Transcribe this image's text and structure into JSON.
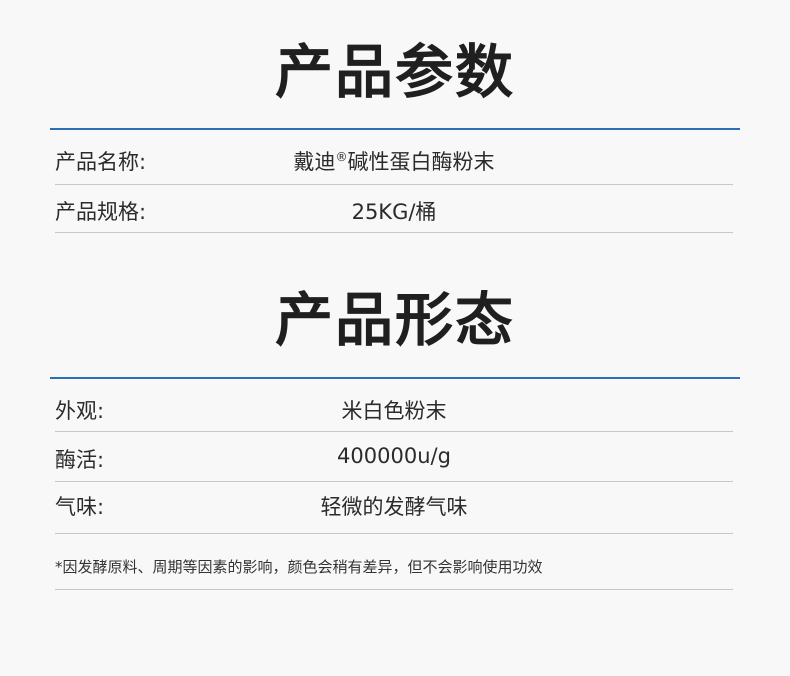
{
  "params": {
    "title": "产品参数",
    "rows": [
      {
        "label": "产品名称:",
        "value_prefix": "戴迪",
        "value_mark": "®",
        "value_suffix": "碱性蛋白酶粉末"
      },
      {
        "label": "产品规格:",
        "value": "25KG/桶"
      }
    ]
  },
  "form": {
    "title": "产品形态",
    "rows": [
      {
        "label": "外观:",
        "value": "米白色粉末"
      },
      {
        "label": "酶活:",
        "value": "400000u/g"
      },
      {
        "label": "气味:",
        "value": "轻微的发酵气味"
      }
    ]
  },
  "note": "*因发酵原料、周期等因素的影响，颜色会稍有差异，但不会影响使用功效",
  "colors": {
    "accent_rule": "#2a6fb8",
    "background": "#f8f8f9"
  }
}
